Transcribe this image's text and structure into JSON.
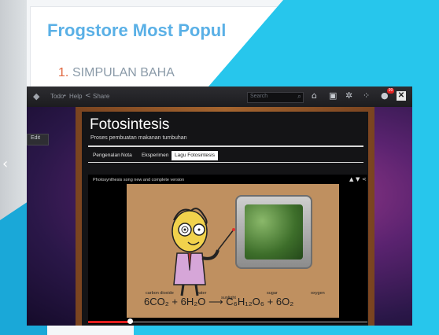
{
  "background_page": {
    "title": "Frogstore Most Popul",
    "list_number": "1.",
    "list_text": "SIMPULAN BAHA",
    "left_arrow_icon": "chevron-left-icon"
  },
  "topbar": {
    "todo_label": "Todo",
    "separator": "•",
    "help_label": "Help",
    "share_label": "Share",
    "search_placeholder": "Search",
    "notification_count": "99",
    "icons": [
      "frog-logo-icon",
      "share-icon",
      "search-icon",
      "home-icon",
      "bookmark-icon",
      "settings-icon",
      "apps-icon",
      "chat-icon",
      "close-icon"
    ]
  },
  "edit_button": {
    "label": "Edit"
  },
  "page": {
    "title": "Fotosintesis",
    "subtitle": "Proses pembuatan makanan tumbuhan",
    "tabs": [
      {
        "label": "Pengenalan",
        "active": false
      },
      {
        "label": "Nota",
        "active": false
      },
      {
        "label": "Eksperimen",
        "active": false
      },
      {
        "label": "Lagu Fotosintesis",
        "active": true
      }
    ]
  },
  "video": {
    "title": "Photosynthesis song new and complete version",
    "equation": {
      "labels": [
        "carbon dioxide",
        "water",
        "sunlight",
        "sugar",
        "oxygen"
      ],
      "text": "6CO₂ + 6H₂O ⟶ C₆H₁₂O₆ + 6O₂"
    },
    "progress": 0.15
  },
  "colors": {
    "accent_cyan": "#27c6ec",
    "topbar": "#1c1c1f",
    "progress": "#e21c1c",
    "bg_title": "#5ab0e6"
  }
}
